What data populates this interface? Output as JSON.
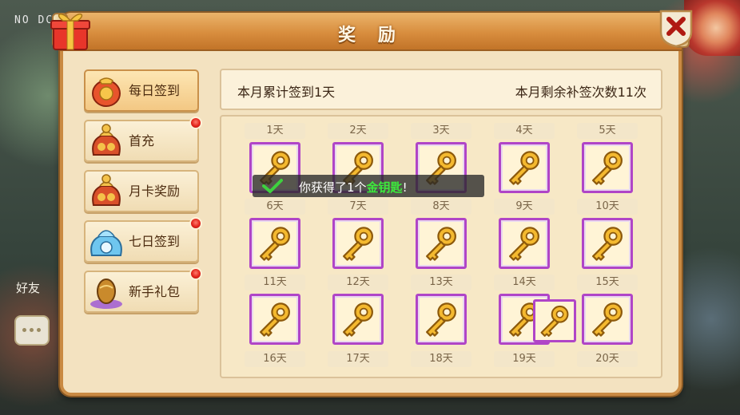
{
  "background": {
    "overlay_text": "NO DC",
    "friend_label": "好友"
  },
  "dialog": {
    "title": "奖 励"
  },
  "sidebar": {
    "items": [
      {
        "label": "每日签到",
        "icon": "red-coin-pouch-icon",
        "active": true,
        "badge": false
      },
      {
        "label": "首充",
        "icon": "treasure-sack-icon",
        "active": false,
        "badge": true
      },
      {
        "label": "月卡奖励",
        "icon": "treasure-sack-icon",
        "active": false,
        "badge": false
      },
      {
        "label": "七日签到",
        "icon": "blue-crystal-pouch-icon",
        "active": false,
        "badge": true
      },
      {
        "label": "新手礼包",
        "icon": "golden-egg-icon",
        "active": false,
        "badge": true
      }
    ]
  },
  "info": {
    "left_text": "本月累计签到1天",
    "right_text": "本月剩余补签次数11次"
  },
  "grid": {
    "days": [
      "1天",
      "2天",
      "3天",
      "4天",
      "5天",
      "6天",
      "7天",
      "8天",
      "9天",
      "10天",
      "11天",
      "12天",
      "13天",
      "14天",
      "15天",
      "16天",
      "17天",
      "18天",
      "19天",
      "20天"
    ],
    "item_icon": "golden-key-icon",
    "claimed_days": [
      1
    ]
  },
  "toast": {
    "prefix": "你获得了1个",
    "item": "金钥匙",
    "suffix": "!"
  },
  "colors": {
    "tile_border": "#b045c7",
    "highlight": "#3cea3c",
    "badge": "#e3241b"
  }
}
